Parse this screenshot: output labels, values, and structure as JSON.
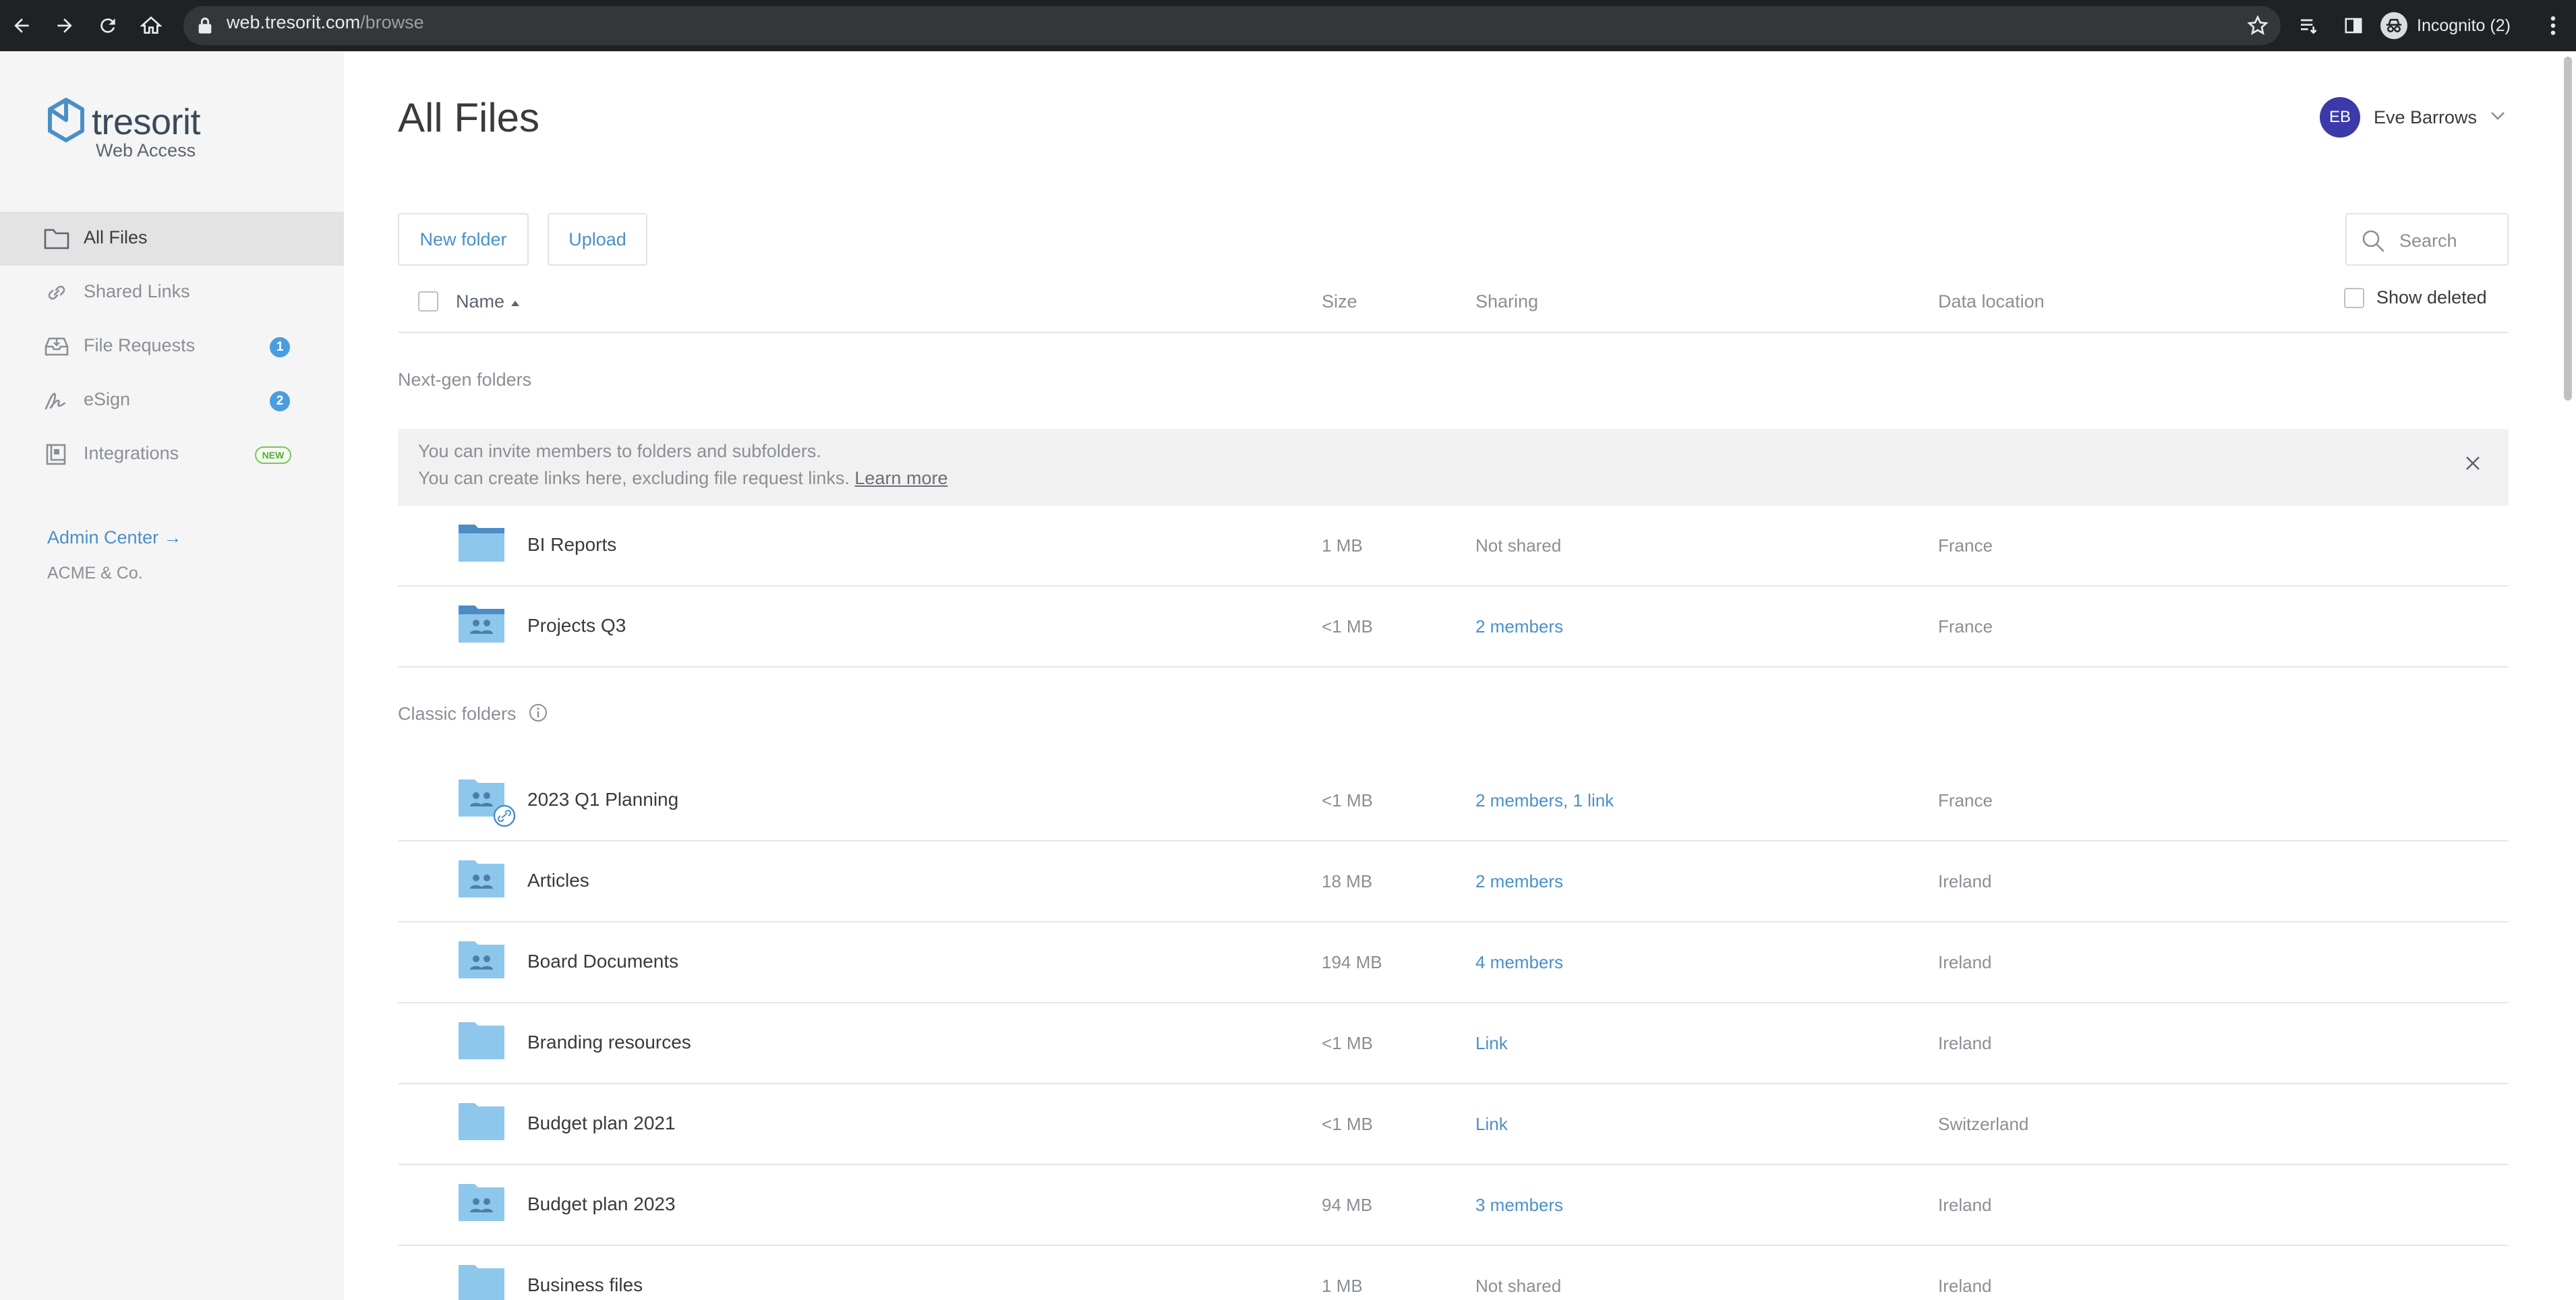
{
  "browser": {
    "url_host": "web.tresorit.com",
    "url_path": "/browse",
    "profile_label": "Incognito (2)"
  },
  "sidebar": {
    "logo_text": "tresorit",
    "logo_sub": "Web Access",
    "items": [
      {
        "label": "All Files",
        "icon": "folder-icon",
        "active": true
      },
      {
        "label": "Shared Links",
        "icon": "link-icon"
      },
      {
        "label": "File Requests",
        "icon": "inbox-icon",
        "badge": "1"
      },
      {
        "label": "eSign",
        "icon": "signature-icon",
        "badge": "2"
      },
      {
        "label": "Integrations",
        "icon": "integrations-icon",
        "tag": "NEW"
      }
    ],
    "admin_link": "Admin Center →",
    "org_name": "ACME & Co."
  },
  "header": {
    "title": "All Files",
    "user_initials": "EB",
    "user_name": "Eve Barrows"
  },
  "toolbar": {
    "new_folder_label": "New folder",
    "upload_label": "Upload",
    "search_placeholder": "Search",
    "show_deleted_label": "Show deleted"
  },
  "table": {
    "columns": {
      "name": "Name",
      "size": "Size",
      "sharing": "Sharing",
      "location": "Data location"
    }
  },
  "sections": {
    "nextgen_label": "Next-gen folders",
    "classic_label": "Classic folders"
  },
  "banner": {
    "line1": "You can invite members to folders and subfolders.",
    "line2": "You can create links here, excluding file request links.",
    "learn_more": "Learn more"
  },
  "nextgen_rows": [
    {
      "name": "BI Reports",
      "size": "1 MB",
      "sharing": "Not shared",
      "location": "France"
    },
    {
      "name": "Projects Q3",
      "size": "<1 MB",
      "sharing": "2 members",
      "location": "France"
    }
  ],
  "classic_rows": [
    {
      "name": "2023 Q1 Planning",
      "size": "<1 MB",
      "sharing": "2 members, 1 link",
      "location": "France"
    },
    {
      "name": "Articles",
      "size": "18 MB",
      "sharing": "2 members",
      "location": "Ireland"
    },
    {
      "name": "Board Documents",
      "size": "194 MB",
      "sharing": "4 members",
      "location": "Ireland"
    },
    {
      "name": "Branding resources",
      "size": "<1 MB",
      "sharing": "Link",
      "location": "Ireland"
    },
    {
      "name": "Budget plan 2021",
      "size": "<1 MB",
      "sharing": "Link",
      "location": "Switzerland"
    },
    {
      "name": "Budget plan 2023",
      "size": "94 MB",
      "sharing": "3 members",
      "location": "Ireland"
    },
    {
      "name": "Business files",
      "size": "1 MB",
      "sharing": "Not shared",
      "location": "Ireland"
    }
  ],
  "colors": {
    "accent": "#4a90c8",
    "avatar": "#3b3aa8",
    "folder": "#8ec7ec",
    "badge": "#4a9de0"
  }
}
